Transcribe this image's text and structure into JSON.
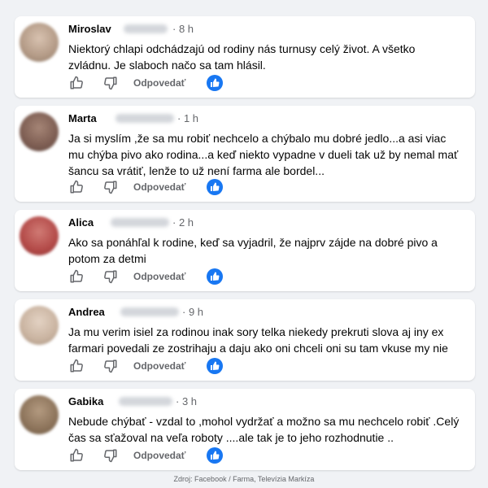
{
  "comments": [
    {
      "name": "Miroslav",
      "time": "· 8 h",
      "text": "Niektorý chlapi odchádzajú od rodiny nás turnusy celý život. A všetko zvládnu. Je slaboch načo sa tam hlásil.",
      "reply_label": "Odpovedať",
      "avatar_color": "#b39a86"
    },
    {
      "name": "Marta",
      "time": "· 1 h",
      "text": "Ja si myslím ,že sa mu robiť nechcelo a chýbalo mu dobré jedlo...a asi viac mu chýba pivo ako rodina...a keď niekto vypadne v dueli tak už by nemal mať šancu sa vrátiť, lenže to už není farma ale bordel...",
      "reply_label": "Odpovedať",
      "avatar_color": "#8a6a60"
    },
    {
      "name": "Alica",
      "time": "· 2 h",
      "text": "Ako sa ponáhľal k rodine, keď sa vyjadril, že najprv zájde na dobré pivo a potom za detmi",
      "reply_label": "Odpovedať",
      "avatar_color": "#b34a48"
    },
    {
      "name": "Andrea",
      "time": "· 9 h",
      "text": "Ja mu verim isiel za rodinou inak sory telka niekedy prekruti slova aj iny ex farmari povedali ze zostrihaju a daju ako oni chceli oni su tam vkuse my nie",
      "reply_label": "Odpovedať",
      "avatar_color": "#c9b3a0"
    },
    {
      "name": "Gabika",
      "time": "· 3 h",
      "text": "Nebude chýbať - vzdal to ,mohol vydržať a možno sa mu nechcelo robiť .Celý čas sa sťažoval na veľa roboty ....ale tak je to jeho rozhodnutie ..",
      "reply_label": "Odpovedať",
      "avatar_color": "#8c735a"
    }
  ],
  "source": "Zdroj: Facebook / Farma, Televízia Markíza",
  "colors": {
    "background": "#f0f2f5",
    "card": "#ffffff",
    "accent": "#1877f2",
    "secondary_text": "#65676b"
  }
}
